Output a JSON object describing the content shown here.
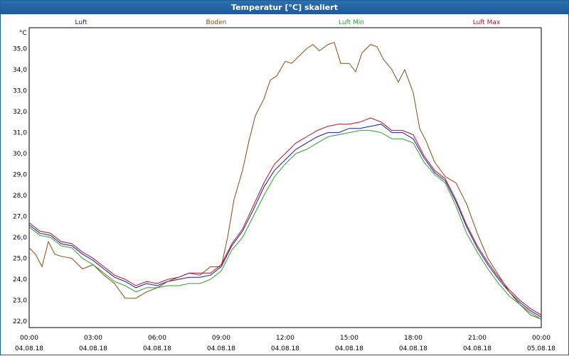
{
  "window": {
    "title": "Temperatur [°C] skaliert"
  },
  "chart_data": {
    "type": "line",
    "title": "Temperatur [°C] skaliert",
    "ylabel": "°C",
    "ylim": [
      21.7,
      36.0
    ],
    "xlim": [
      0,
      24
    ],
    "grid": true,
    "legend_placement": "top",
    "y_ticks": [
      "22,0",
      "23,0",
      "24,0",
      "25,0",
      "26,0",
      "27,0",
      "28,0",
      "29,0",
      "30,0",
      "31,0",
      "32,0",
      "33,0",
      "34,0",
      "35,0"
    ],
    "x_ticks": [
      {
        "time": "00:00",
        "date": "04.08.18"
      },
      {
        "time": "03:00",
        "date": "04.08.18"
      },
      {
        "time": "06:00",
        "date": "04.08.18"
      },
      {
        "time": "09:00",
        "date": "04.08.18"
      },
      {
        "time": "12:00",
        "date": "04.08.18"
      },
      {
        "time": "15:00",
        "date": "04.08.18"
      },
      {
        "time": "18:00",
        "date": "04.08.18"
      },
      {
        "time": "21:00",
        "date": "04.08.18"
      },
      {
        "time": "00:00",
        "date": "05.08.18"
      }
    ],
    "series": [
      {
        "name": "Luft",
        "color": "#1a1aa8",
        "x": [
          0,
          0.5,
          1,
          1.5,
          2,
          2.5,
          3,
          3.5,
          4,
          4.5,
          5,
          5.5,
          6,
          6.5,
          7,
          7.5,
          8,
          8.5,
          9,
          9.5,
          10,
          10.5,
          11,
          11.5,
          12,
          12.5,
          13,
          13.5,
          14,
          14.5,
          15,
          15.5,
          16,
          16.5,
          17,
          17.5,
          18,
          18.5,
          19,
          19.5,
          20,
          20.5,
          21,
          21.5,
          22,
          22.5,
          23,
          23.5,
          24
        ],
        "y": [
          26.6,
          26.2,
          26.1,
          25.7,
          25.6,
          25.2,
          24.9,
          24.5,
          24.1,
          23.9,
          23.6,
          23.8,
          23.7,
          23.9,
          24.0,
          24.1,
          24.1,
          24.2,
          24.6,
          25.6,
          26.3,
          27.3,
          28.4,
          29.2,
          29.7,
          30.2,
          30.5,
          30.8,
          31.0,
          31.0,
          31.2,
          31.2,
          31.3,
          31.4,
          31.0,
          31.0,
          30.7,
          29.8,
          29.1,
          28.7,
          27.7,
          26.5,
          25.5,
          24.7,
          24.0,
          23.4,
          22.9,
          22.5,
          22.2
        ]
      },
      {
        "name": "Boden",
        "color": "#8b4a12",
        "x": [
          0,
          0.3,
          0.6,
          0.9,
          1.2,
          1.5,
          2,
          2.5,
          3,
          3.5,
          4,
          4.5,
          5,
          5.5,
          6,
          6.5,
          7,
          7.5,
          8,
          8.5,
          9,
          9.3,
          9.6,
          10,
          10.3,
          10.6,
          11,
          11.3,
          11.6,
          12,
          12.3,
          12.6,
          13,
          13.3,
          13.6,
          14,
          14.3,
          14.6,
          15,
          15.3,
          15.6,
          16,
          16.3,
          16.6,
          17,
          17.3,
          17.6,
          18,
          18.3,
          18.6,
          19,
          19.5,
          20,
          20.5,
          21,
          21.5,
          22,
          22.5,
          23,
          23.5,
          24
        ],
        "y": [
          25.5,
          25.2,
          24.6,
          25.8,
          25.2,
          25.1,
          25.0,
          24.5,
          24.7,
          24.2,
          23.8,
          23.1,
          23.1,
          23.4,
          23.6,
          23.9,
          24.1,
          24.3,
          24.2,
          24.6,
          24.6,
          26.0,
          27.8,
          29.2,
          30.6,
          31.8,
          32.6,
          33.5,
          33.7,
          34.4,
          34.3,
          34.6,
          35.0,
          35.2,
          34.9,
          35.2,
          35.3,
          34.3,
          34.3,
          33.9,
          34.8,
          35.2,
          35.1,
          34.5,
          34.0,
          33.4,
          34.0,
          32.9,
          31.2,
          30.6,
          29.6,
          28.9,
          28.6,
          27.6,
          26.2,
          25.0,
          24.2,
          23.4,
          22.8,
          22.3,
          22.1
        ]
      },
      {
        "name": "Luft Min",
        "color": "#2aa02a",
        "x": [
          0,
          0.5,
          1,
          1.5,
          2,
          2.5,
          3,
          3.5,
          4,
          4.5,
          5,
          5.5,
          6,
          6.5,
          7,
          7.5,
          8,
          8.5,
          9,
          9.5,
          10,
          10.5,
          11,
          11.5,
          12,
          12.5,
          13,
          13.5,
          14,
          14.5,
          15,
          15.5,
          16,
          16.5,
          17,
          17.5,
          18,
          18.5,
          19,
          19.5,
          20,
          20.5,
          21,
          21.5,
          22,
          22.5,
          23,
          23.5,
          24
        ],
        "y": [
          26.5,
          26.1,
          26.0,
          25.6,
          25.5,
          25.0,
          24.7,
          24.3,
          23.9,
          23.7,
          23.4,
          23.6,
          23.6,
          23.7,
          23.7,
          23.8,
          23.8,
          24.0,
          24.4,
          25.4,
          26.0,
          27.0,
          28.0,
          28.9,
          29.5,
          30.0,
          30.2,
          30.5,
          30.8,
          30.9,
          31.0,
          31.1,
          31.1,
          31.0,
          30.7,
          30.7,
          30.5,
          29.6,
          29.0,
          28.6,
          27.5,
          26.2,
          25.3,
          24.5,
          23.8,
          23.2,
          22.8,
          22.4,
          22.1
        ]
      },
      {
        "name": "Luft Max",
        "color": "#b0102a",
        "x": [
          0,
          0.5,
          1,
          1.5,
          2,
          2.5,
          3,
          3.5,
          4,
          4.5,
          5,
          5.5,
          6,
          6.5,
          7,
          7.5,
          8,
          8.5,
          9,
          9.5,
          10,
          10.5,
          11,
          11.5,
          12,
          12.5,
          13,
          13.5,
          14,
          14.5,
          15,
          15.5,
          16,
          16.5,
          17,
          17.5,
          18,
          18.5,
          19,
          19.5,
          20,
          20.5,
          21,
          21.5,
          22,
          22.5,
          23,
          23.5,
          24
        ],
        "y": [
          26.7,
          26.3,
          26.2,
          25.8,
          25.7,
          25.3,
          25.0,
          24.6,
          24.2,
          24.0,
          23.7,
          23.9,
          23.8,
          24.0,
          24.1,
          24.3,
          24.3,
          24.3,
          24.7,
          25.7,
          26.4,
          27.5,
          28.6,
          29.5,
          30.0,
          30.5,
          30.8,
          31.1,
          31.3,
          31.4,
          31.4,
          31.5,
          31.7,
          31.5,
          31.1,
          31.1,
          30.9,
          29.9,
          29.2,
          28.8,
          27.8,
          26.6,
          25.6,
          24.8,
          24.1,
          23.5,
          23.0,
          22.6,
          22.3
        ]
      }
    ]
  }
}
